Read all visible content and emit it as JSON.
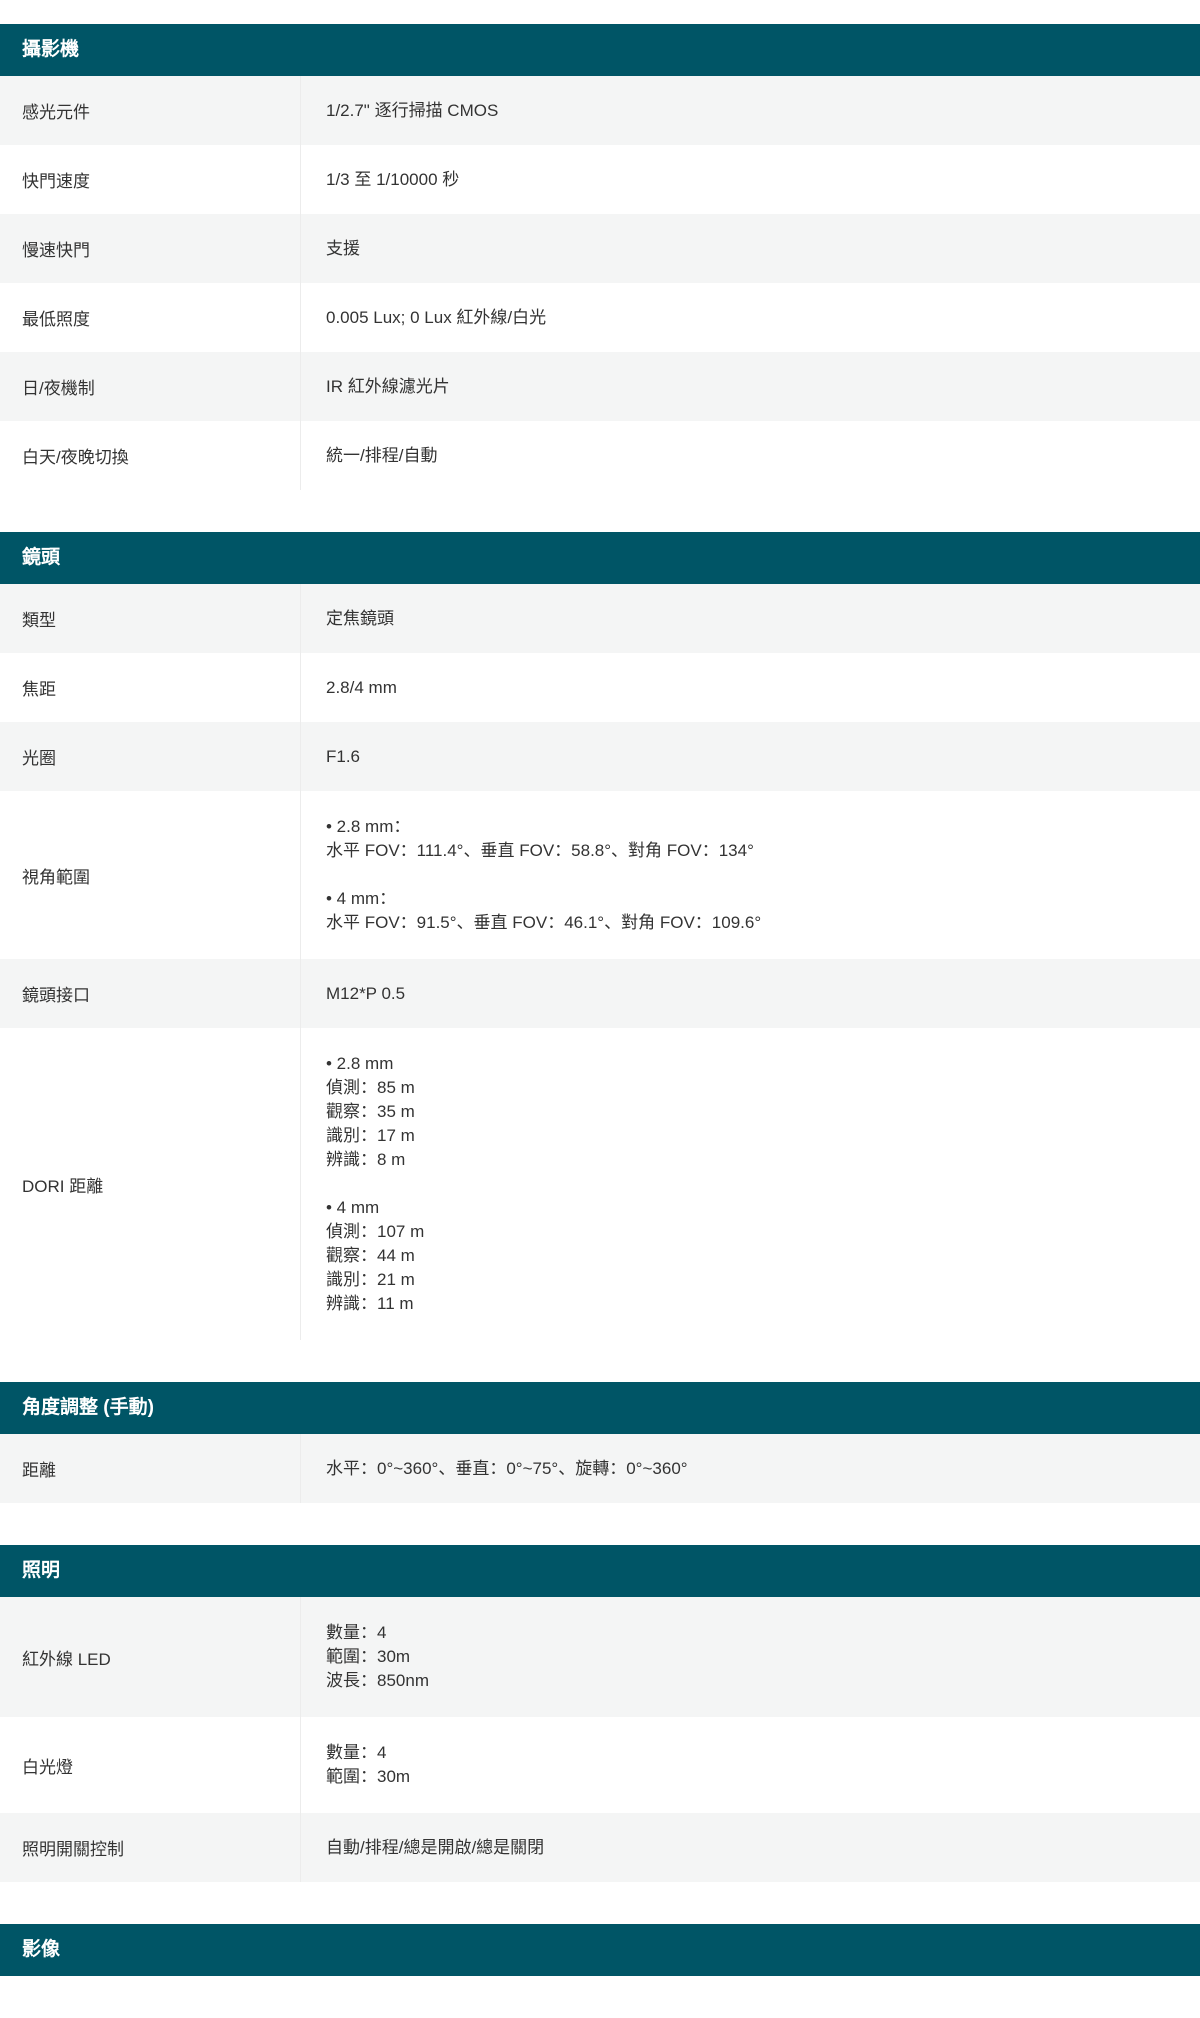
{
  "sections": [
    {
      "title": "攝影機",
      "rows": [
        {
          "label": "感光元件",
          "lines": [
            "1/2.7\" 逐行掃描 CMOS"
          ]
        },
        {
          "label": "快門速度",
          "lines": [
            "1/3 至 1/10000 秒"
          ]
        },
        {
          "label": "慢速快門",
          "lines": [
            "支援"
          ]
        },
        {
          "label": "最低照度",
          "lines": [
            "0.005 Lux; 0 Lux 紅外線/白光"
          ]
        },
        {
          "label": "日/夜機制",
          "lines": [
            "IR 紅外線濾光片"
          ]
        },
        {
          "label": "白天/夜晚切換",
          "lines": [
            "統一/排程/自動"
          ]
        }
      ]
    },
    {
      "title": "鏡頭",
      "rows": [
        {
          "label": "類型",
          "lines": [
            "定焦鏡頭"
          ]
        },
        {
          "label": "焦距",
          "lines": [
            "2.8/4 mm"
          ]
        },
        {
          "label": "光圈",
          "lines": [
            "F1.6"
          ]
        },
        {
          "label": "視角範圍",
          "lines": [
            "• 2.8 mm：",
            "水平 FOV：111.4°、垂直 FOV：58.8°、對角 FOV：134°",
            "",
            "• 4 mm：",
            "水平 FOV：91.5°、垂直 FOV：46.1°、對角 FOV：109.6°"
          ]
        },
        {
          "label": "鏡頭接口",
          "lines": [
            "M12*P 0.5"
          ]
        },
        {
          "label": "DORI 距離",
          "lines": [
            "• 2.8 mm",
            "偵測：85 m",
            "觀察：35 m",
            "識別：17 m",
            "辨識：8 m",
            "",
            "• 4 mm",
            "偵測：107 m",
            "觀察：44 m",
            "識別：21 m",
            "辨識：11 m"
          ]
        }
      ]
    },
    {
      "title": "角度調整 (手動)",
      "rows": [
        {
          "label": "距離",
          "lines": [
            "水平：0°~360°、垂直：0°~75°、旋轉：0°~360°"
          ]
        }
      ]
    },
    {
      "title": "照明",
      "rows": [
        {
          "label": "紅外線 LED",
          "lines": [
            "數量：4",
            "範圍：30m",
            "波長：850nm"
          ]
        },
        {
          "label": "白光燈",
          "lines": [
            "數量：4",
            "範圍：30m"
          ]
        },
        {
          "label": "照明開關控制",
          "lines": [
            "自動/排程/總是開啟/總是關閉"
          ]
        }
      ]
    },
    {
      "title": "影像",
      "rows": []
    }
  ]
}
